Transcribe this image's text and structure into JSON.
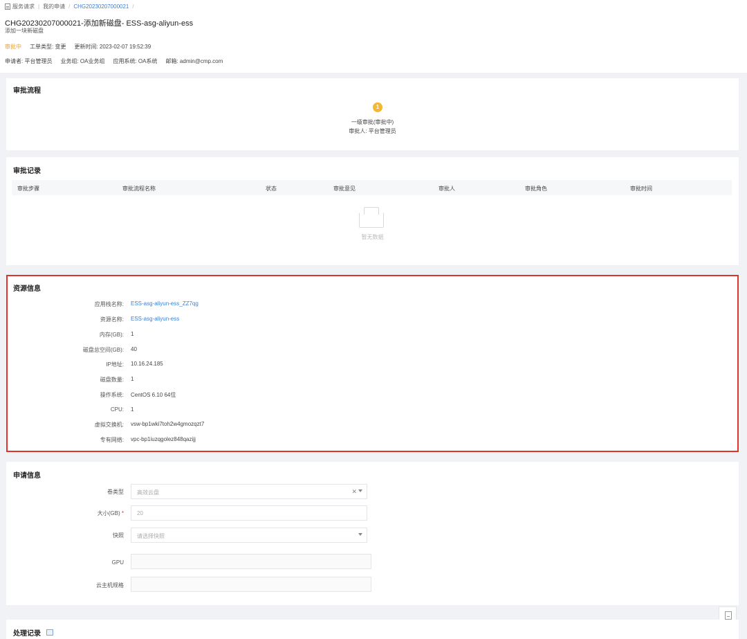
{
  "breadcrumb": {
    "items": [
      "服务请求",
      "我的申请",
      "CHG20230207000021"
    ],
    "separator": "/"
  },
  "header": {
    "title": "CHG20230207000021-添加新磁盘- ESS-asg-aliyun-ess",
    "subtitle": "添加一块新磁盘",
    "status": "审批中",
    "order_type": "工单类型: 变更",
    "update_time": "更新时间: 2023-02-07 19:52:39",
    "applicant": "申请者: 平台管理员",
    "business_group": "业务组: OA业务组",
    "app_system": "应用系统: OA系统",
    "email": "邮箱: admin@cmp.com"
  },
  "approval_flow": {
    "title": "审批流程",
    "step_number": "1",
    "step_name": "一级审批(审批中)",
    "approver": "审批人: 平台管理员"
  },
  "approval_records": {
    "title": "审批记录",
    "columns": [
      "审批步骤",
      "审批流程名称",
      "状态",
      "审批意见",
      "审批人",
      "审批角色",
      "审批时间"
    ],
    "empty_text": "暂无数据"
  },
  "resource_info": {
    "title": "资源信息",
    "rows": [
      {
        "label": "应用栈名称:",
        "value": "ESS-asg-aliyun-ess_ZZ7qg"
      },
      {
        "label": "资源名称:",
        "value": "ESS-asg-aliyun-ess"
      },
      {
        "label": "内存(GB):",
        "value": "1"
      },
      {
        "label": "磁盘总空间(GB):",
        "value": "40"
      },
      {
        "label": "IP地址:",
        "value": "10.16.24.185"
      },
      {
        "label": "磁盘数量:",
        "value": "1"
      },
      {
        "label": "操作系统:",
        "value": "CentOS 6.10 64位"
      },
      {
        "label": "CPU:",
        "value": "1"
      },
      {
        "label": "虚拟交换机:",
        "value": "vsw-bp1wki7toh2w4gmozqzt7"
      },
      {
        "label": "专有网络:",
        "value": "vpc-bp1iuzqgolez848qazijj"
      }
    ]
  },
  "apply_info": {
    "title": "申请信息",
    "volume_type_label": "卷类型",
    "volume_type_value": "高效云盘",
    "size_label": "大小(GB)",
    "size_required": "*",
    "size_value": "20",
    "snapshot_label": "快照",
    "snapshot_placeholder": "请选择快照",
    "gpu_label": "GPU",
    "spec_label": "云主机规格"
  },
  "process_records": {
    "title": "处理记录"
  },
  "icons": {
    "breadcrumb": "document-icon",
    "side": "bookmark-icon",
    "records": "records-icon"
  }
}
